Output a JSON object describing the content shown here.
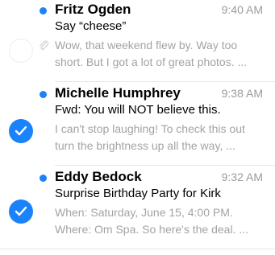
{
  "messages": [
    {
      "sender": "Fritz Ogden",
      "time": "9:40 AM",
      "subject": "Say “cheese”",
      "preview_line1": "Wow, that weekend flew by. Way too",
      "preview_line2": "short. But I got a lot of great photos. ...",
      "unread": true,
      "selected": false,
      "icon": "attachment-icon"
    },
    {
      "sender": "Michelle Humphrey",
      "time": "9:38 AM",
      "subject": "Fwd: You will NOT believe this.",
      "preview_line1": "I can't stop laughing! To check this out",
      "preview_line2": "turn the brightness up all the way, ...",
      "unread": true,
      "selected": true,
      "icon": "checkmark-icon"
    },
    {
      "sender": "Eddy Bedock",
      "time": "9:32 AM",
      "subject": "Surprise Birthday Party for Kirk",
      "preview_line1": "When: Saturday, June 15, 4:00 PM.",
      "preview_line2": "Where: Om Spa. So here's the deal. ...",
      "unread": true,
      "selected": true,
      "icon": "checkmark-icon"
    }
  ],
  "colors": {
    "accent": "#1a82fb",
    "preview_text": "#a3a3a3",
    "time_text": "#9b9b9b"
  }
}
